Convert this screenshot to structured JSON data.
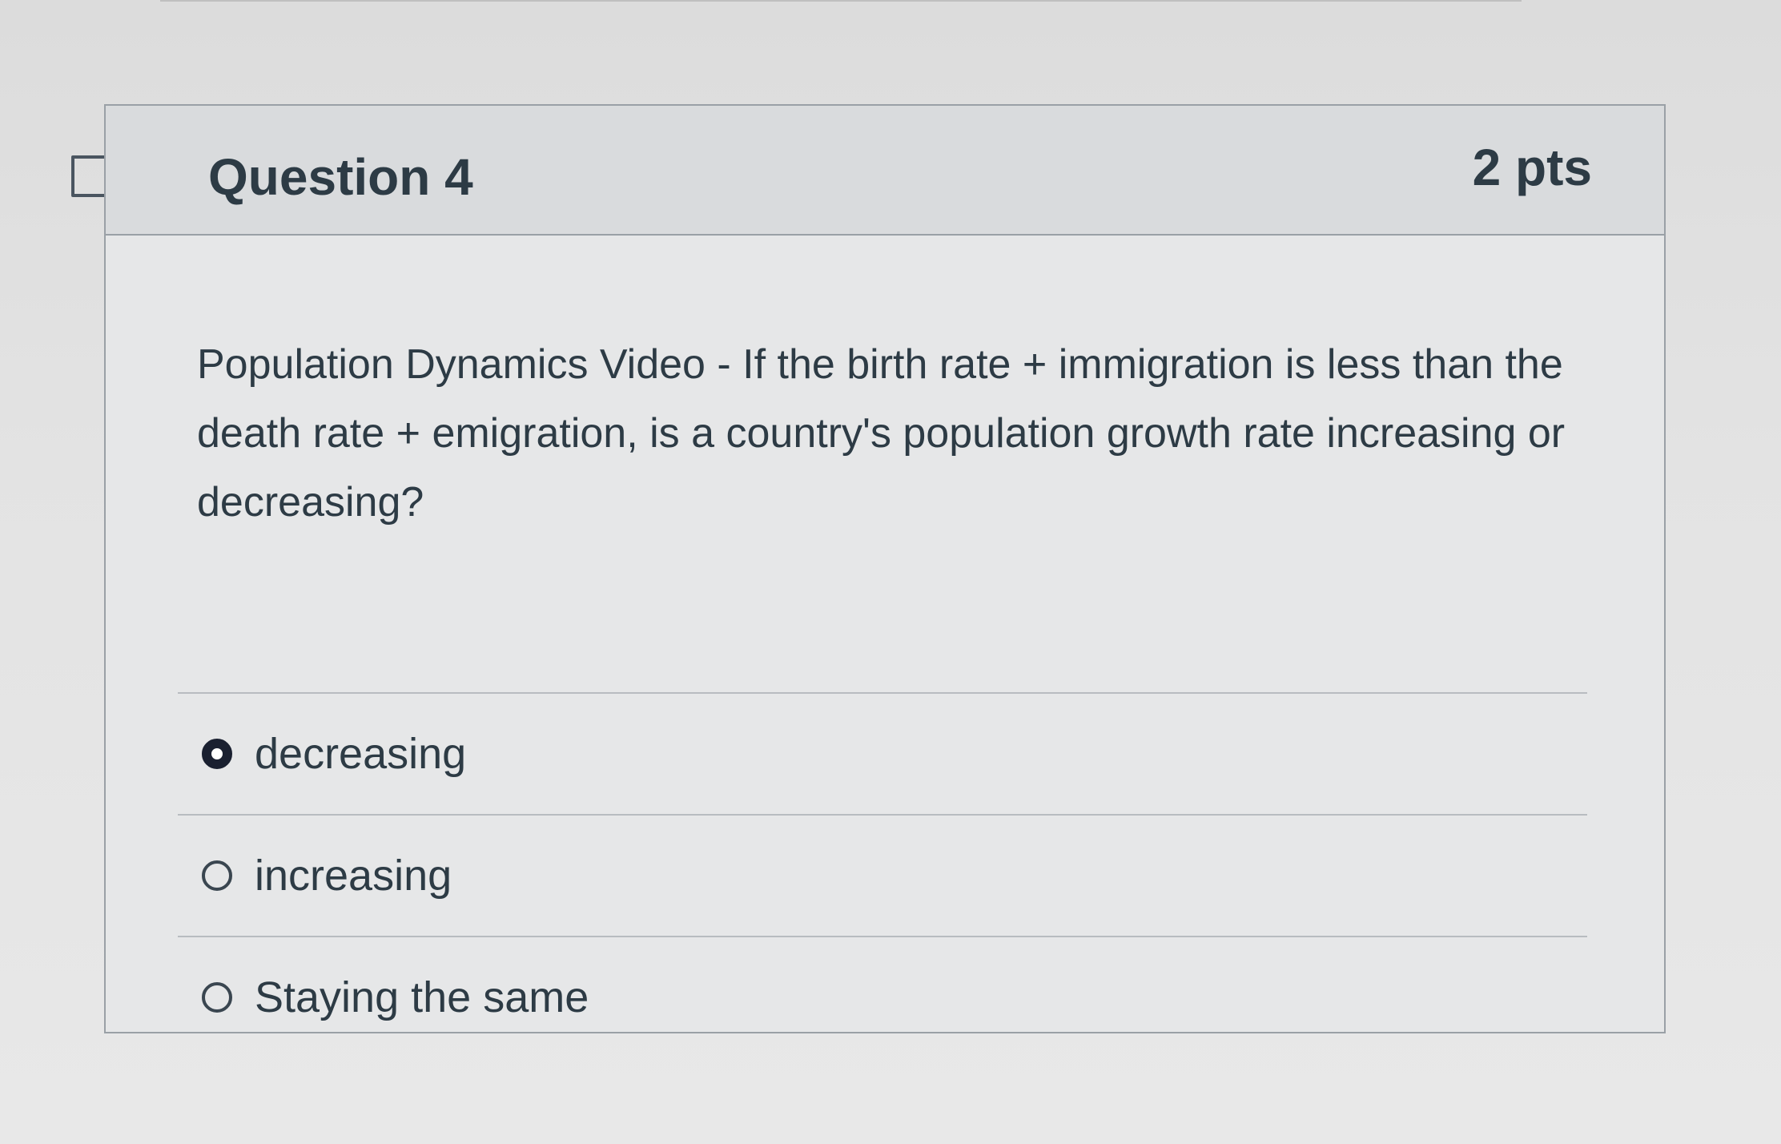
{
  "question": {
    "title": "Question 4",
    "points": "2 pts",
    "text": "Population Dynamics Video - If the birth rate + immigration is less than the death rate + emigration, is a country's population growth rate increasing or decreasing?",
    "flag_icon": "flag-outline-icon"
  },
  "answers": [
    {
      "label": "decreasing",
      "selected": true
    },
    {
      "label": "increasing",
      "selected": false
    },
    {
      "label": "Staying the same",
      "selected": false
    }
  ],
  "colors": {
    "text": "#2d3b45",
    "header_bg": "#d9dbdd",
    "border": "#9aa0a6",
    "radio_selected": "#1a2030"
  }
}
